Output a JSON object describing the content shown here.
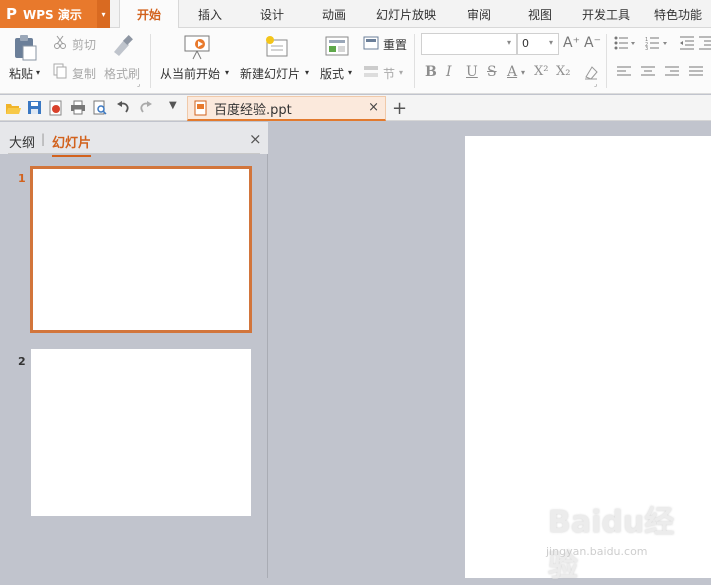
{
  "app": {
    "logo": "P",
    "name": "WPS 演示",
    "dropdown": "▾"
  },
  "menu_tabs": [
    "开始",
    "插入",
    "设计",
    "动画",
    "幻灯片放映",
    "审阅",
    "视图",
    "开发工具",
    "特色功能"
  ],
  "ribbon": {
    "paste": "粘贴",
    "cut": "剪切",
    "copy": "复制",
    "format_painter": "格式刷",
    "from_current": "从当前开始",
    "new_slide": "新建幻灯片",
    "layout": "版式",
    "reset": "重置",
    "section": "节",
    "font_name": "",
    "font_size": "0",
    "grow": "A⁺",
    "shrink": "A⁻",
    "bold": "B",
    "italic": "I",
    "underline": "U",
    "strike": "S",
    "fontcolor": "A",
    "superscript": "X²",
    "subscript": "X₂"
  },
  "document": {
    "tab_name": "百度经验.ppt",
    "close": "×",
    "add": "+"
  },
  "panel": {
    "outline_tab": "大纲",
    "slides_tab": "幻灯片",
    "pipe": "|",
    "close": "×"
  },
  "slides": [
    {
      "number": "1",
      "selected": true
    },
    {
      "number": "2",
      "selected": false
    }
  ],
  "watermark": {
    "brand": "Baidu经验",
    "url": "jingyan.baidu.com"
  },
  "colors": {
    "accent": "#e8792c",
    "active_text": "#d2621d",
    "panel_bg": "#c1c4cd"
  }
}
